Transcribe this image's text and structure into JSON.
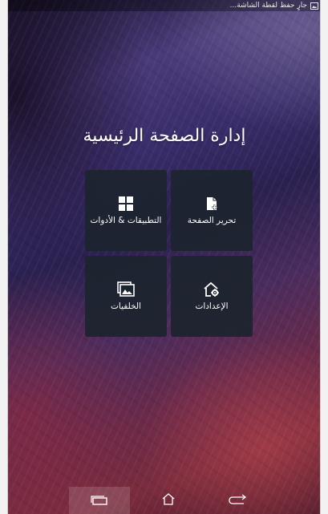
{
  "statusbar": {
    "notice": "جارٍ حفظ لقطة الشاشة...",
    "notice_icon": "screenshot-icon"
  },
  "home_manager": {
    "title": "إدارة الصفحة الرئيسية",
    "tiles": [
      {
        "label": "التطبيقات & الأدوات",
        "icon": "grid-icon"
      },
      {
        "label": "تحرير الصفحة",
        "icon": "edit-page-icon"
      },
      {
        "label": "الخلفيات",
        "icon": "wallpaper-icon"
      },
      {
        "label": "الإعدادات",
        "icon": "home-settings-icon"
      }
    ]
  },
  "navigation": {
    "recents_icon": "recents-icon",
    "home_icon": "home-icon",
    "back_icon": "back-icon"
  },
  "colors": {
    "tile_background": "#1c242e",
    "text": "#ffffff"
  }
}
